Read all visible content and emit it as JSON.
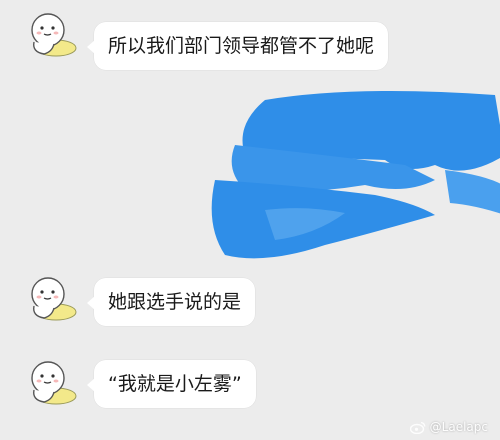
{
  "messages": [
    {
      "text": "所以我们部门领导都管不了她呢"
    },
    {
      "text": "她跟选手说的是"
    },
    {
      "text": "“我就是小左雾”"
    }
  ],
  "watermark": {
    "text": "@Laelapc",
    "icon": "weibo-icon"
  },
  "colors": {
    "background": "#ececec",
    "bubble": "#ffffff",
    "redaction": "#2f8ee8"
  }
}
